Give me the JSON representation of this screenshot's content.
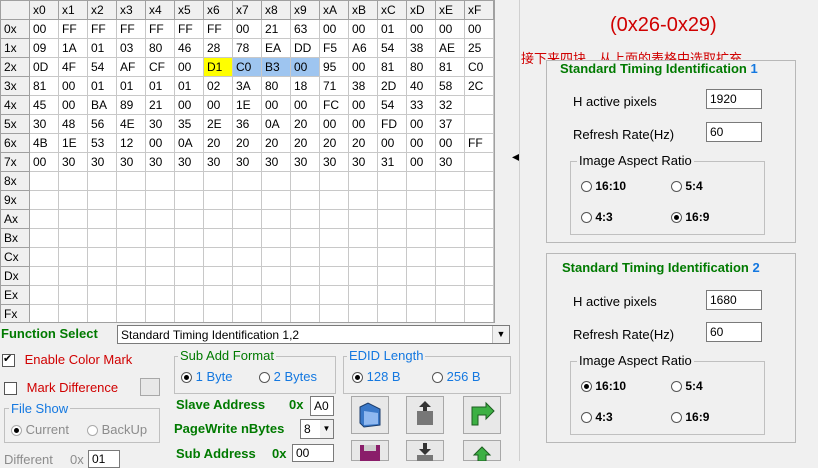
{
  "grid": {
    "columns": [
      "x0",
      "x1",
      "x2",
      "x3",
      "x4",
      "x5",
      "x6",
      "x7",
      "x8",
      "x9",
      "xA",
      "xB",
      "xC",
      "xD",
      "xE",
      "xF"
    ],
    "rows": [
      {
        "label": "0x",
        "cells": [
          "00",
          "FF",
          "FF",
          "FF",
          "FF",
          "FF",
          "FF",
          "00",
          "21",
          "63",
          "00",
          "00",
          "01",
          "00",
          "00",
          "00"
        ]
      },
      {
        "label": "1x",
        "cells": [
          "09",
          "1A",
          "01",
          "03",
          "80",
          "46",
          "28",
          "78",
          "EA",
          "DD",
          "F5",
          "A6",
          "54",
          "38",
          "AE",
          "25"
        ]
      },
      {
        "label": "2x",
        "cells": [
          "0D",
          "4F",
          "54",
          "AF",
          "CF",
          "00",
          "D1",
          "C0",
          "B3",
          "00",
          "95",
          "00",
          "81",
          "80",
          "81",
          "C0"
        ]
      },
      {
        "label": "3x",
        "cells": [
          "81",
          "00",
          "01",
          "01",
          "01",
          "01",
          "02",
          "3A",
          "80",
          "18",
          "71",
          "38",
          "2D",
          "40",
          "58",
          "2C"
        ]
      },
      {
        "label": "4x",
        "cells": [
          "45",
          "00",
          "BA",
          "89",
          "21",
          "00",
          "00",
          "1E",
          "00",
          "00",
          "FC",
          "00",
          "54",
          "33",
          "32",
          ""
        ]
      },
      {
        "label": "5x",
        "cells": [
          "30",
          "48",
          "56",
          "4E",
          "30",
          "35",
          "2E",
          "36",
          "0A",
          "20",
          "00",
          "00",
          "FD",
          "00",
          "37",
          ""
        ]
      },
      {
        "label": "6x",
        "cells": [
          "4B",
          "1E",
          "53",
          "12",
          "00",
          "0A",
          "20",
          "20",
          "20",
          "20",
          "20",
          "20",
          "00",
          "00",
          "00",
          "FF"
        ]
      },
      {
        "label": "7x",
        "cells": [
          "00",
          "30",
          "30",
          "30",
          "30",
          "30",
          "30",
          "30",
          "30",
          "30",
          "30",
          "30",
          "31",
          "00",
          "30",
          ""
        ]
      },
      {
        "label": "8x",
        "cells": []
      },
      {
        "label": "9x",
        "cells": []
      },
      {
        "label": "Ax",
        "cells": []
      },
      {
        "label": "Bx",
        "cells": []
      },
      {
        "label": "Cx",
        "cells": []
      },
      {
        "label": "Dx",
        "cells": []
      },
      {
        "label": "Ex",
        "cells": []
      },
      {
        "label": "Fx",
        "cells": []
      }
    ],
    "selected_yellow": [
      [
        2,
        6
      ]
    ],
    "selected_blue": [
      [
        2,
        7
      ],
      [
        2,
        8
      ],
      [
        2,
        9
      ]
    ]
  },
  "annotation": {
    "range": "(0x26-0x29)",
    "note": "接下来四块，从上面的表格中选取扩充"
  },
  "function_select": {
    "label": "Function Select",
    "value": "Standard Timing Identification 1,2"
  },
  "left": {
    "enable_color_mark": "Enable Color Mark",
    "mark_difference": "Mark Difference",
    "file_show": "File Show",
    "current": "Current",
    "backup": "BackUp",
    "different": "Different",
    "different_prefix": "0x",
    "different_value": "01"
  },
  "sub_add": {
    "title": "Sub Add Format",
    "opt1": "1 Byte",
    "opt2": "2 Bytes",
    "slave_label": "Slave Address",
    "slave_prefix": "0x",
    "slave_value": "A0",
    "pagewrite_label": "PageWrite nBytes",
    "pagewrite_value": "8",
    "subaddr_label": "Sub Address",
    "subaddr_prefix": "0x",
    "subaddr_value": "00"
  },
  "edid": {
    "title": "EDID Length",
    "opt1": "128 B",
    "opt2": "256 B"
  },
  "std1": {
    "title": "Standard Timing Identification",
    "num": "1",
    "h_label": "H active pixels",
    "h_value": "1920",
    "r_label": "Refresh Rate(Hz)",
    "r_value": "60",
    "ar_title": "Image Aspect Ratio",
    "ar": [
      "16:10",
      "5:4",
      "4:3",
      "16:9"
    ],
    "ar_selected": "16:9"
  },
  "std2": {
    "title": "Standard Timing Identification",
    "num": "2",
    "h_label": "H active pixels",
    "h_value": "1680",
    "r_label": "Refresh Rate(Hz)",
    "r_value": "60",
    "ar_title": "Image Aspect Ratio",
    "ar": [
      "16:10",
      "5:4",
      "4:3",
      "16:9"
    ],
    "ar_selected": "16:10"
  },
  "icons": [
    "open-folder-icon",
    "chip-read-icon",
    "arrow-green-icon",
    "save-disk-icon",
    "chip-write-icon",
    "arrow-green-2-icon"
  ],
  "colors": {
    "accent_green": "#007a00",
    "accent_blue": "#1478e0",
    "annotation_red": "#d00000",
    "cell_yellow": "#ffff00",
    "cell_blue": "#9ec5f0"
  }
}
